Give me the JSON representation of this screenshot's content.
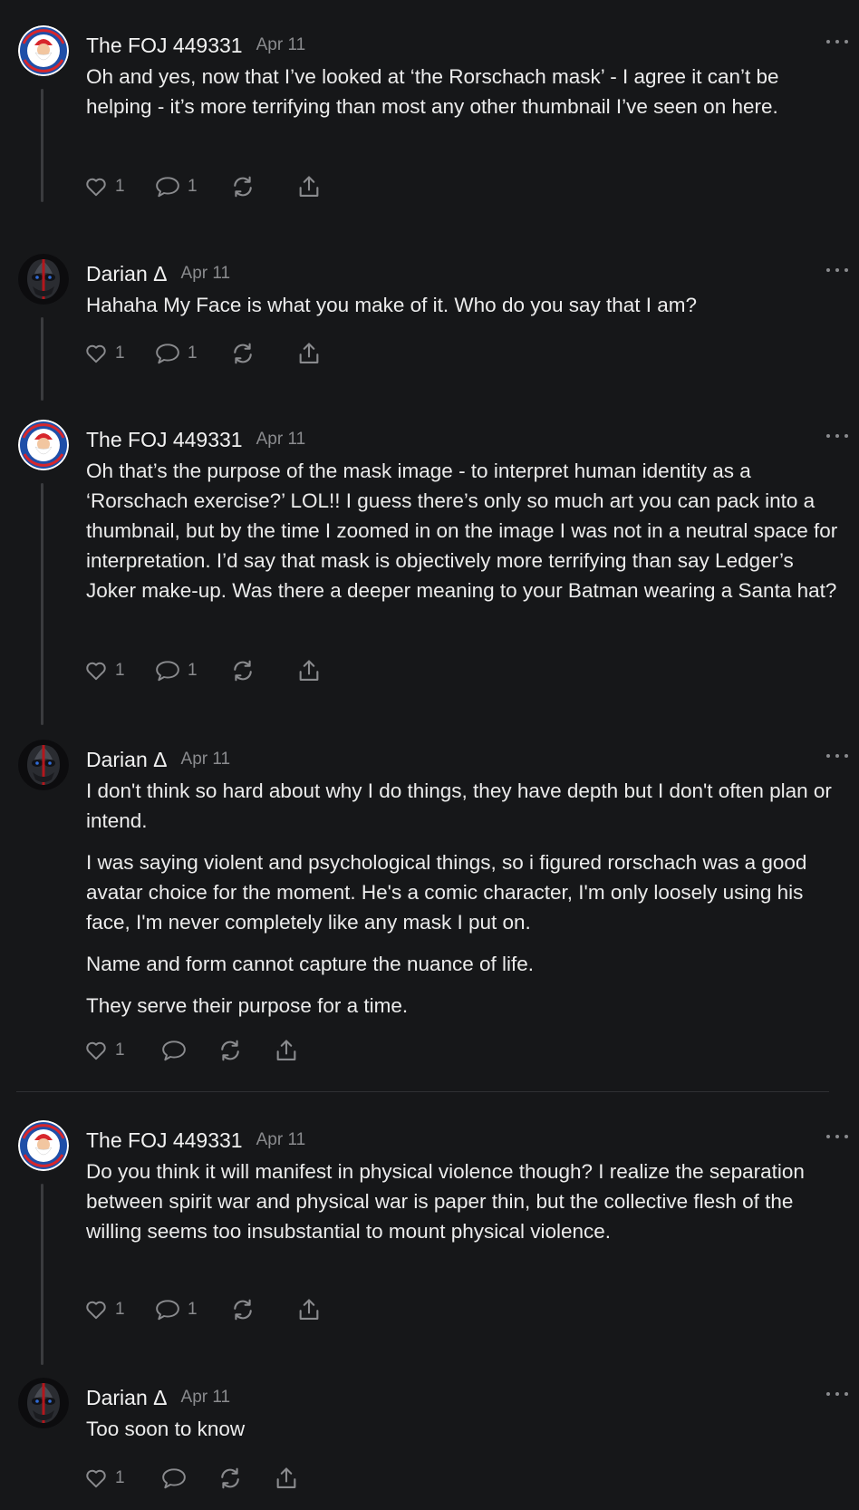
{
  "thread": {
    "posts": [
      {
        "author": "The FOJ 449331",
        "date": "Apr 11",
        "avatar_icon": "papa-john-avatar-icon",
        "paragraphs": [
          "Oh and yes, now that I’ve looked at ‘the Rorschach mask’ - I agree it can’t be helping - it’s more terrifying than most any other thumbnail I’ve seen on here."
        ],
        "likes": "1",
        "comments": "1"
      },
      {
        "author": "Darian Δ",
        "date": "Apr 11",
        "avatar_icon": "rorschach-mask-avatar-icon",
        "paragraphs": [
          "Hahaha My Face is what you make of it. Who do you say that I am?"
        ],
        "likes": "1",
        "comments": "1"
      },
      {
        "author": "The FOJ 449331",
        "date": "Apr 11",
        "avatar_icon": "papa-john-avatar-icon",
        "paragraphs": [
          "Oh that’s the purpose of the mask image - to interpret human identity as a ‘Rorschach exercise?’ LOL!! I guess there’s only so much art you can pack into a thumbnail, but by the time I zoomed in on the image I was not in a neutral space for interpretation. I’d say that mask is objectively more terrifying than say Ledger’s Joker make-up. Was there a deeper meaning to your Batman wearing a Santa hat?"
        ],
        "likes": "1",
        "comments": "1"
      },
      {
        "author": "Darian Δ",
        "date": "Apr 11",
        "avatar_icon": "rorschach-mask-avatar-icon",
        "paragraphs": [
          "I don't think so hard about why I do things, they have depth but I don't often plan or intend.",
          "I was saying violent and psychological things, so i figured rorschach was a good avatar choice for the moment. He's a comic character, I'm only loosely using his face, I'm never completely like any mask I put on.",
          "Name and form cannot capture the nuance of life.",
          "They serve their purpose for a time."
        ],
        "likes": "1",
        "comments": ""
      },
      {
        "author": "The FOJ 449331",
        "date": "Apr 11",
        "avatar_icon": "papa-john-avatar-icon",
        "paragraphs": [
          "Do you think it will manifest in physical violence though? I realize the separation between spirit war and physical war is paper thin, but the collective flesh of the willing seems too insubstantial to mount physical violence."
        ],
        "likes": "1",
        "comments": "1"
      },
      {
        "author": "Darian Δ",
        "date": "Apr 11",
        "avatar_icon": "rorschach-mask-avatar-icon",
        "paragraphs": [
          "Too soon to know"
        ],
        "likes": "1",
        "comments": ""
      }
    ]
  },
  "icons": {
    "like": "heart-icon",
    "comment": "comment-bubble-icon",
    "restack": "restack-icon",
    "share": "share-icon",
    "more": "more-options-icon"
  },
  "colors": {
    "background": "#161719",
    "text": "#ececec",
    "muted": "#8a8b8e",
    "thread_line": "#3a3b3e"
  }
}
